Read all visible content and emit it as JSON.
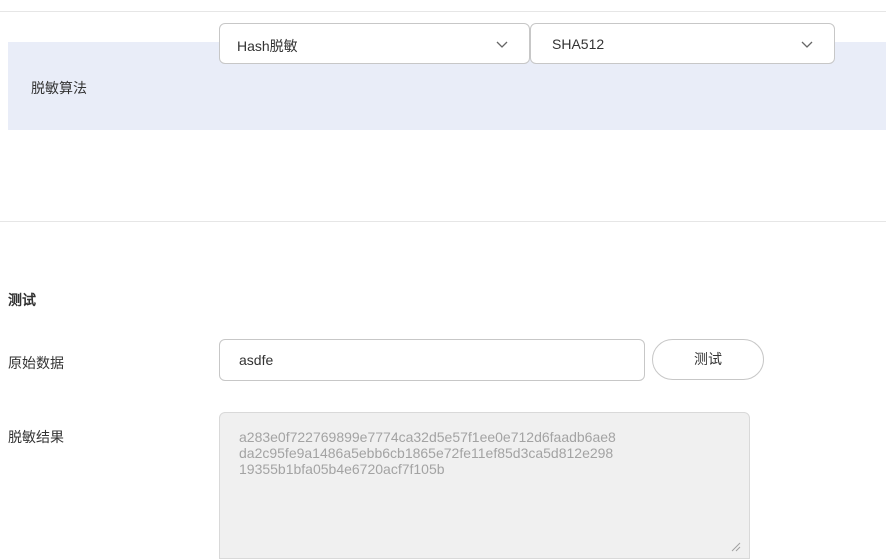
{
  "algorithm": {
    "label": "脱敏算法",
    "method_select": {
      "value": "Hash脱敏",
      "icon": "chevron-down-icon"
    },
    "hash_select": {
      "value": "SHA512",
      "icon": "chevron-down-icon"
    }
  },
  "test": {
    "title": "测试",
    "raw_label": "原始数据",
    "raw_value": "asdfe",
    "test_button": "测试",
    "result_label": "脱敏结果",
    "result_lines": [
      "a283e0f722769899e7774ca32d5e57f1ee0e712d6faadb6ae8",
      "da2c95fe9a1486a5ebb6cb1865e72fe11ef85d3ca5d812e298",
      "19355b1bfa05b4e6720acf7f105b"
    ]
  },
  "colors": {
    "row_highlight": "#e9edf8",
    "border": "#c7c7c7",
    "readonly_bg": "#f0f0f0",
    "readonly_text": "#a3a3a3"
  }
}
